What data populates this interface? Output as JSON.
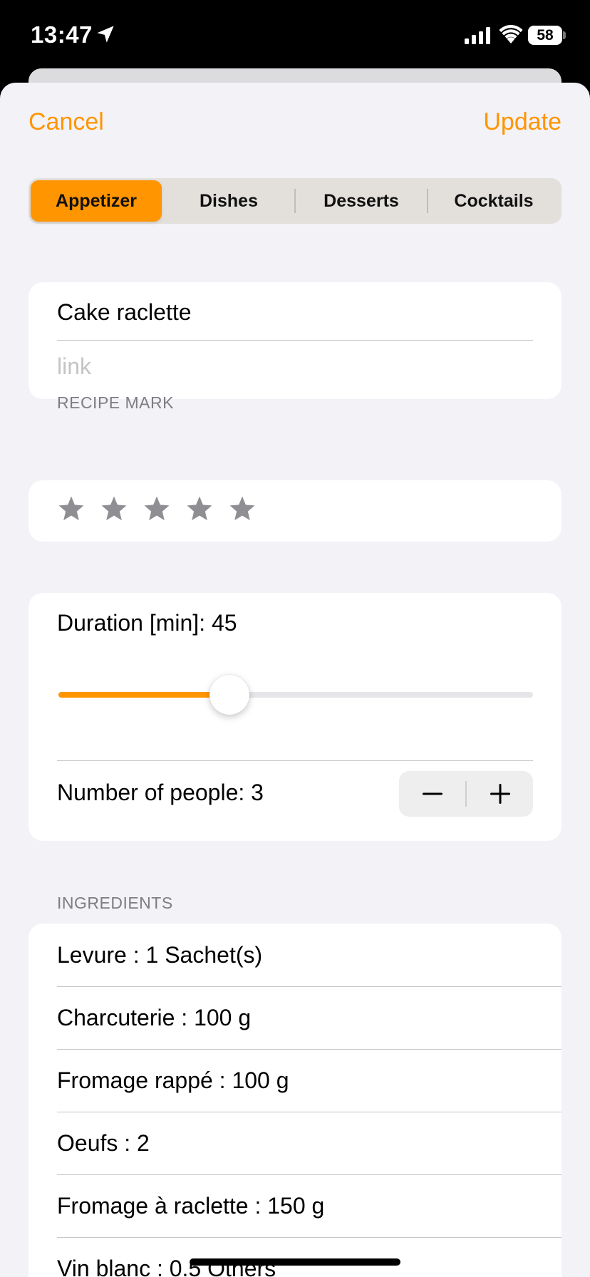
{
  "status_bar": {
    "time": "13:47",
    "battery": "58"
  },
  "nav": {
    "cancel_label": "Cancel",
    "update_label": "Update"
  },
  "categories": {
    "selected": "Appetizer",
    "options": [
      "Appetizer",
      "Dishes",
      "Desserts",
      "Cocktails"
    ]
  },
  "recipe": {
    "title": "Cake raclette",
    "link_placeholder": "link"
  },
  "rating": {
    "section_label": "RECIPE MARK",
    "value": 0,
    "max": 5
  },
  "duration": {
    "label": "Duration [min]: 45",
    "value": 45,
    "min": 0,
    "max": 120,
    "slider_fraction": 0.36
  },
  "people": {
    "label": "Number of people: 3",
    "value": 3
  },
  "ingredients": {
    "section_label": "INGREDIENTS",
    "items": [
      "Levure : 1 Sachet(s)",
      "Charcuterie : 100 g",
      "Fromage rappé : 100 g",
      "Oeufs : 2",
      "Fromage à raclette : 150 g",
      "Vin blanc : 0.5 Others"
    ]
  },
  "colors": {
    "accent": "#ff9500",
    "background": "#f2f2f7",
    "star": "#8e8e93"
  }
}
